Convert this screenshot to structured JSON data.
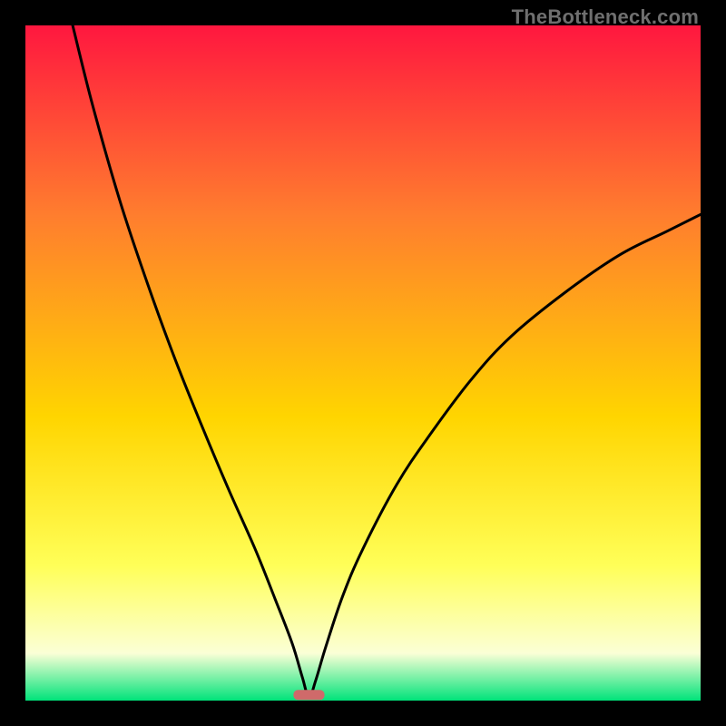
{
  "watermark": "TheBottleneck.com",
  "colors": {
    "gradient_top": "#ff173f",
    "gradient_mid1": "#ff7d2e",
    "gradient_mid2": "#ffd500",
    "gradient_mid3": "#ffff58",
    "gradient_mid4": "#fbffd6",
    "gradient_bottom": "#00e37a",
    "curve": "#000000",
    "marker": "#cf6a6a",
    "frame_bg": "#000000"
  },
  "chart_data": {
    "type": "line",
    "title": "",
    "xlabel": "",
    "ylabel": "",
    "xlim": [
      0,
      100
    ],
    "ylim": [
      0,
      100
    ],
    "grid": false,
    "legend": false,
    "notes": "Bottleneck-style V-curve. Minimum (~0) near x≈42. Left branch rises to ~100 at x≈7; right branch rises to ~72 at x=100.",
    "series": [
      {
        "name": "curve",
        "x": [
          7,
          10,
          14,
          18,
          22,
          26,
          30,
          34,
          37,
          39.5,
          41,
          42,
          43,
          44.5,
          47,
          50,
          55,
          60,
          66,
          72,
          80,
          88,
          95,
          100
        ],
        "y": [
          100,
          88,
          74,
          62,
          51,
          41,
          31.5,
          22.5,
          15,
          8.5,
          3.5,
          0.5,
          3,
          8,
          15.5,
          22.5,
          32,
          39.5,
          47.5,
          54,
          60.5,
          66,
          69.5,
          72
        ]
      }
    ],
    "marker": {
      "x_center": 42,
      "x_halfwidth": 2.3,
      "y": 0.9
    }
  }
}
